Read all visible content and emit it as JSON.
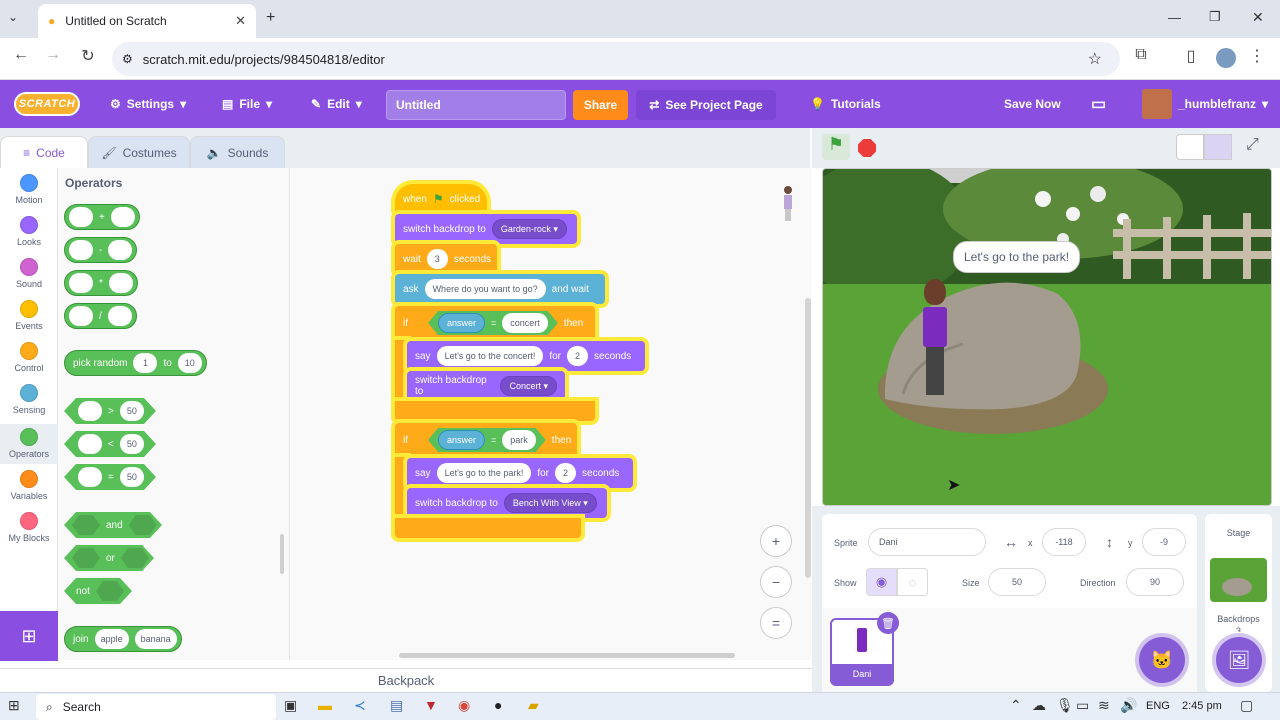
{
  "browser": {
    "tab_title": "Untitled on Scratch",
    "url": "scratch.mit.edu/projects/984504818/editor"
  },
  "menu": {
    "logo": "SCRATCH",
    "settings": "Settings",
    "file": "File",
    "edit": "Edit",
    "project_title": "Untitled",
    "share": "Share",
    "see_project": "See Project Page",
    "tutorials": "Tutorials",
    "save_now": "Save Now",
    "username": "_humblefranz"
  },
  "editor_tabs": {
    "code": "Code",
    "costumes": "Costumes",
    "sounds": "Sounds"
  },
  "categories": [
    {
      "label": "Motion",
      "color": "#4c97ff"
    },
    {
      "label": "Looks",
      "color": "#9966ff"
    },
    {
      "label": "Sound",
      "color": "#cf63cf"
    },
    {
      "label": "Events",
      "color": "#ffbf00"
    },
    {
      "label": "Control",
      "color": "#ffab19"
    },
    {
      "label": "Sensing",
      "color": "#5cb1d6"
    },
    {
      "label": "Operators",
      "color": "#59c059"
    },
    {
      "label": "Variables",
      "color": "#ff8c1a"
    },
    {
      "label": "My Blocks",
      "color": "#ff6680"
    }
  ],
  "palette": {
    "title": "Operators",
    "plus": "+",
    "minus": "-",
    "times": "*",
    "divide": "/",
    "pick_random": "pick random",
    "to": "to",
    "rand_from": "1",
    "rand_to": "10",
    "gt": ">",
    "lt": "<",
    "eq": "=",
    "cmp_value": "50",
    "and": "and",
    "or": "or",
    "not": "not",
    "join": "join",
    "join_a": "apple",
    "join_b": "banana"
  },
  "script": {
    "when": "when",
    "clicked": "clicked",
    "switch_backdrop_to": "switch backdrop to",
    "backdrop1": "Garden-rock",
    "wait": "wait",
    "wait_val": "3",
    "seconds": "seconds",
    "ask": "ask",
    "ask_text": "Where do you want to go?",
    "and_wait": "and wait",
    "if": "if",
    "then": "then",
    "answer": "answer",
    "eq": "=",
    "cond1": "concert",
    "say": "say",
    "say1": "Let's go to the concert!",
    "for": "for",
    "secs": "2",
    "switch_backdrop_short": "switch backdrop to",
    "backdrop2": "Concert",
    "cond2": "park",
    "say2": "Let's go to the park!",
    "backdrop3": "Bench With View"
  },
  "zoom": {
    "in": "+",
    "out": "−",
    "reset": "="
  },
  "backpack": "Backpack",
  "stage": {
    "speech": "Let's go to the park!"
  },
  "sprite": {
    "sprite_label": "Sprite",
    "name": "Dani",
    "x_label": "x",
    "x": "-118",
    "y_label": "y",
    "y": "-9",
    "show_label": "Show",
    "size_label": "Size",
    "size": "50",
    "direction_label": "Direction",
    "direction": "90",
    "thumb_name": "Dani"
  },
  "stage_panel": {
    "title": "Stage",
    "backdrops": "Backdrops",
    "backdrop_count": "3"
  },
  "taskbar": {
    "search": "Search",
    "lang": "ENG",
    "time": "2:45 pm"
  }
}
